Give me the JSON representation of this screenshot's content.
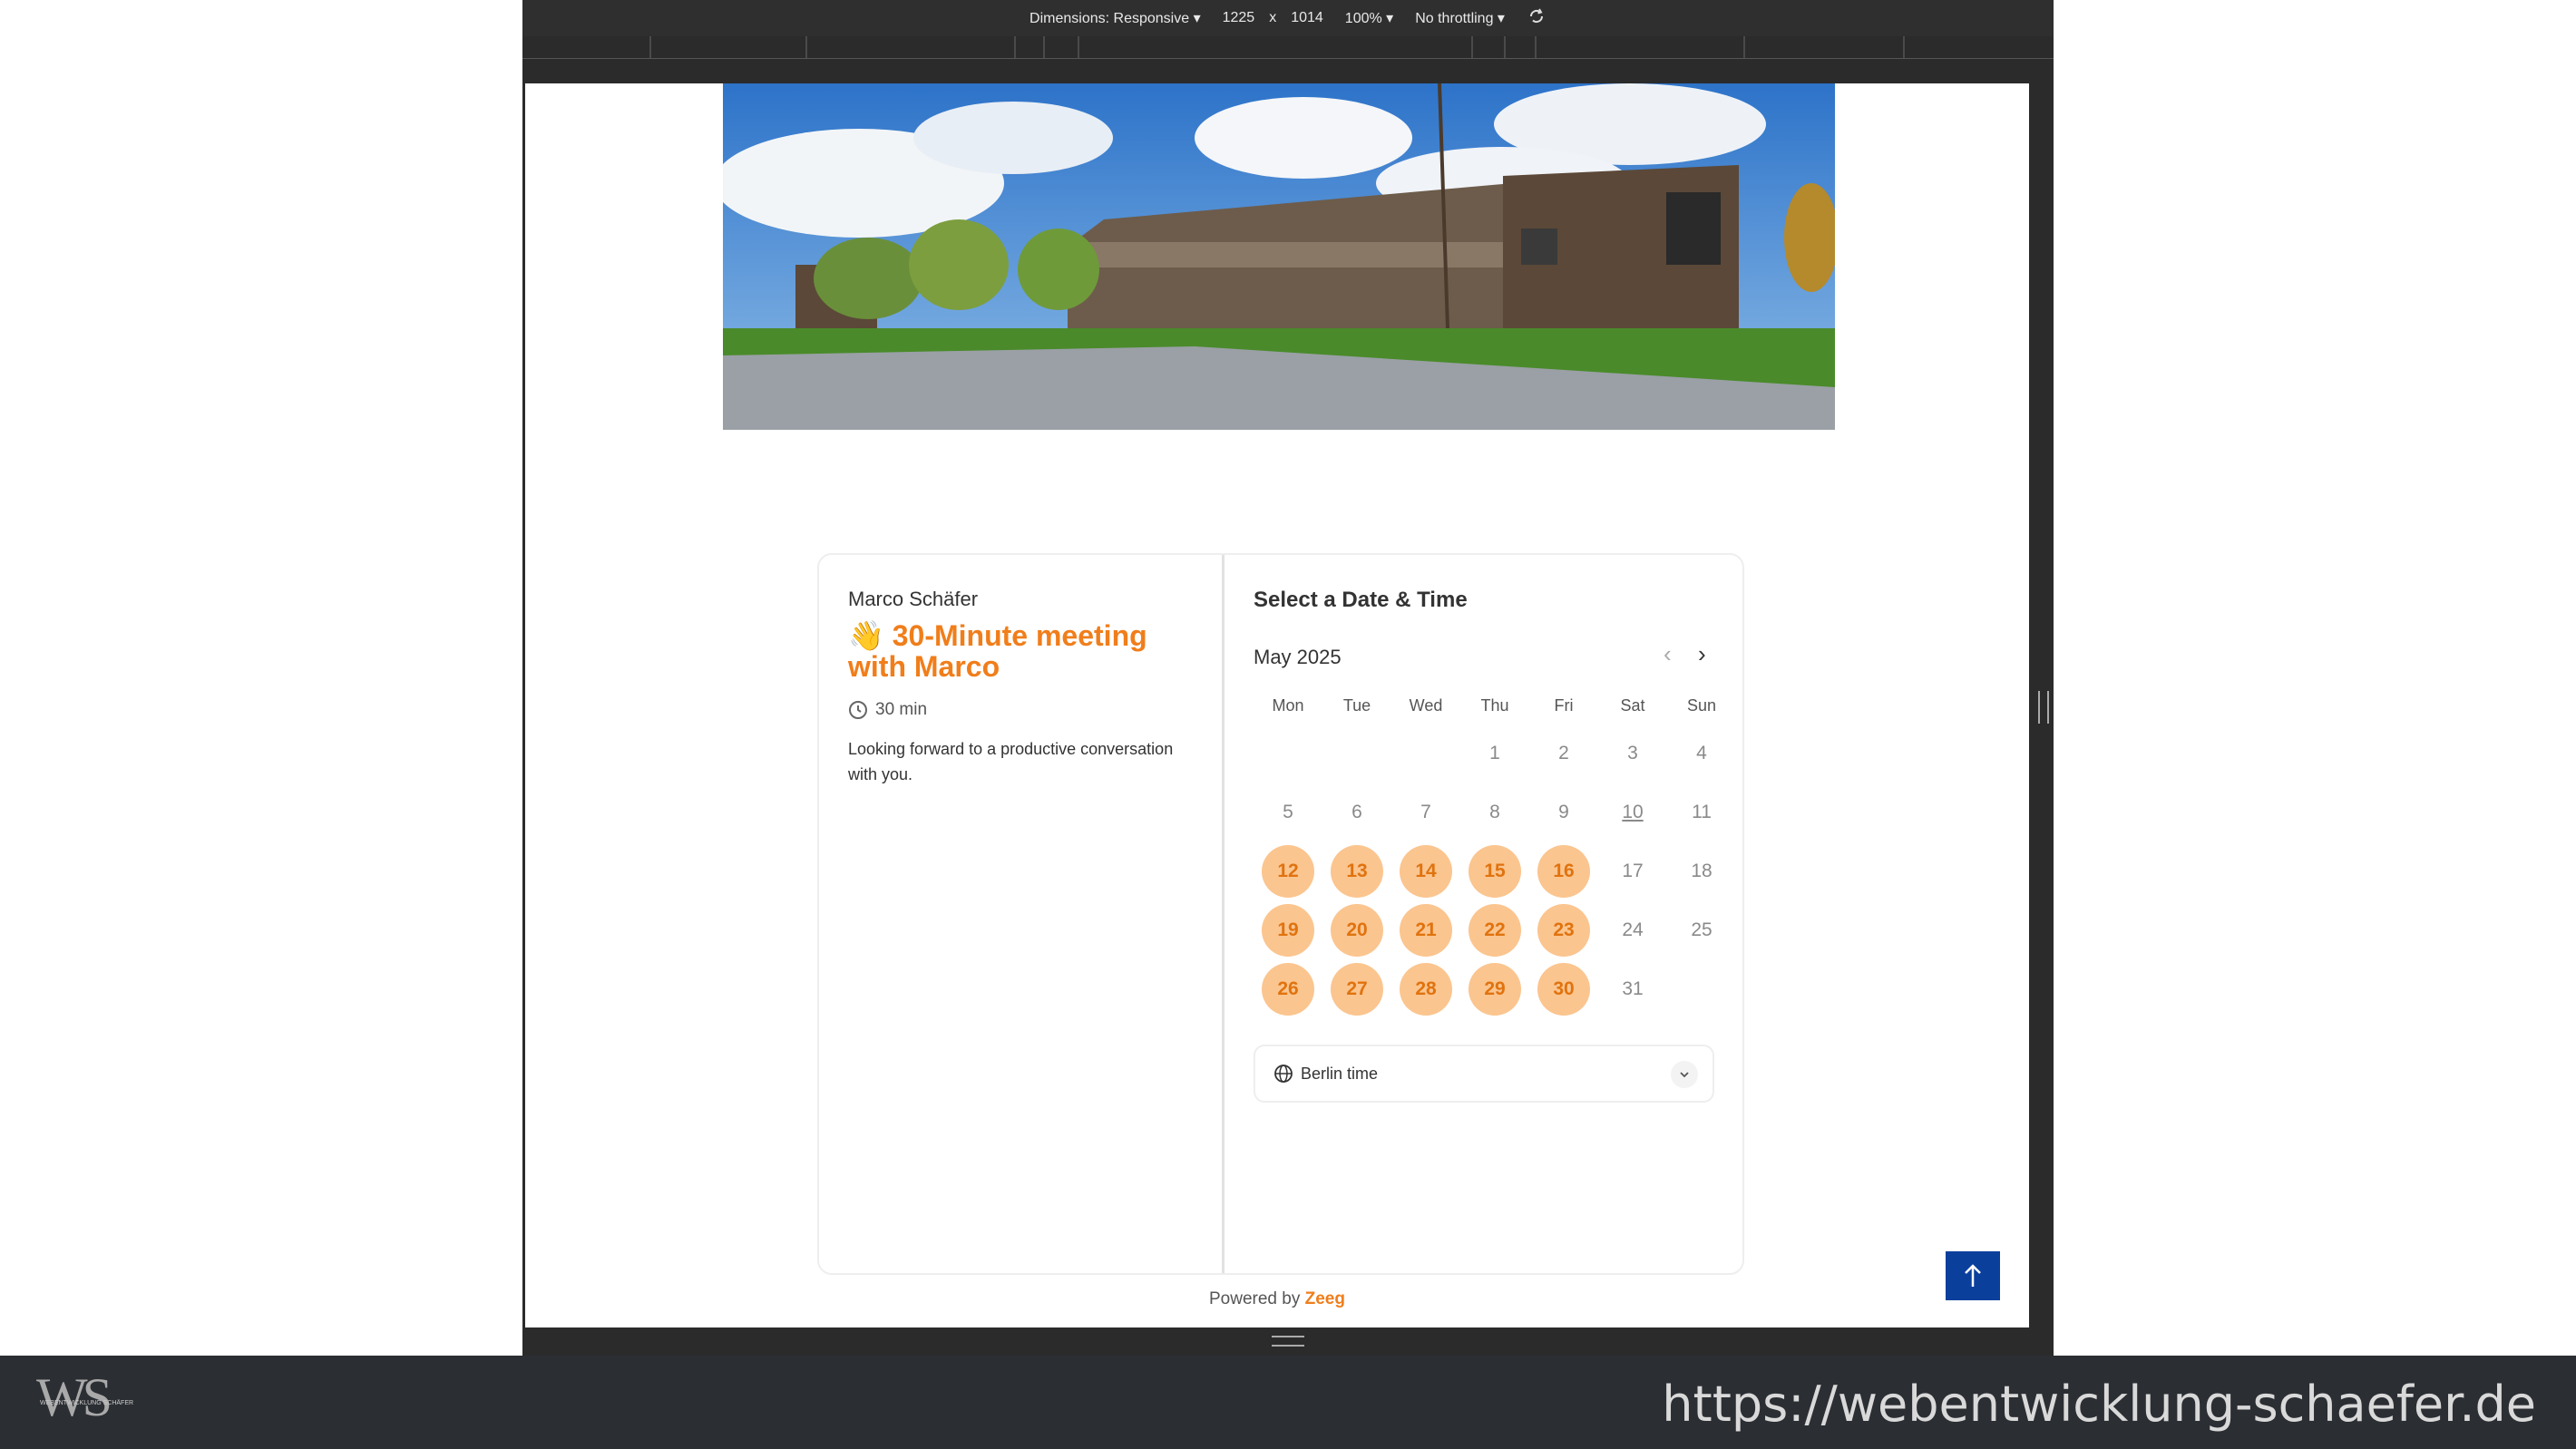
{
  "devtools": {
    "dimensions_label": "Dimensions: Responsive ▾",
    "width": "1225",
    "times": "x",
    "height": "1014",
    "zoom": "100% ▾",
    "throttling": "No throttling ▾"
  },
  "event": {
    "host": "Marco Schäfer",
    "emoji": "👋",
    "title": "30-Minute meeting with Marco",
    "duration": "30 min",
    "description": "Looking forward to a productive conversation with you."
  },
  "calendar": {
    "heading": "Select a Date & Time",
    "month": "May 2025",
    "weekdays": [
      "Mon",
      "Tue",
      "Wed",
      "Thu",
      "Fri",
      "Sat",
      "Sun"
    ],
    "days": [
      "1",
      "2",
      "3",
      "4",
      "5",
      "6",
      "7",
      "8",
      "9",
      "10",
      "11",
      "12",
      "13",
      "14",
      "15",
      "16",
      "17",
      "18",
      "19",
      "20",
      "21",
      "22",
      "23",
      "24",
      "25",
      "26",
      "27",
      "28",
      "29",
      "30",
      "31"
    ],
    "available": [
      12,
      13,
      14,
      15,
      16,
      19,
      20,
      21,
      22,
      23,
      26,
      27,
      28,
      29,
      30
    ],
    "today": 10,
    "timezone": "Berlin time"
  },
  "footer": {
    "powered_prefix": "Powered by",
    "powered_brand": "Zeeg"
  },
  "site": {
    "logo": "WS",
    "logo_sub": "WEBENTWICKLUNG SCHÄFER",
    "url": "https://webentwicklung-schaefer.de"
  },
  "colors": {
    "accent": "#f07e1b",
    "available_bg": "#fbc58f",
    "scroll_top_button": "#0a3f9c"
  }
}
